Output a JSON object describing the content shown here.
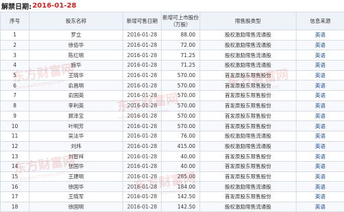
{
  "header": {
    "label": "解禁日期:",
    "date": "2016-01-28"
  },
  "table": {
    "columns": [
      "序号",
      "股东名称",
      "新增可售日期",
      "新增可上市股份（万股）",
      "限售股类型",
      "信息来源"
    ],
    "rows": [
      [
        "1",
        "罗立",
        "2016-01-28",
        "88.00",
        "股权激励限售流通股",
        "英语"
      ],
      [
        "2",
        "徐佰华",
        "2016-01-28",
        "72.00",
        "股权激励限售流通股",
        "英语"
      ],
      [
        "3",
        "陈红明",
        "2016-01-28",
        "71.25",
        "股权激励限售流通股",
        "英语"
      ],
      [
        "4",
        "施华",
        "2016-01-28",
        "71.25",
        "股权激励限售流通股",
        "英语"
      ],
      [
        "5",
        "王晓华",
        "2016-01-28",
        "570.00",
        "首发原股东限售股份",
        "英语"
      ],
      [
        "6",
        "俞昌明",
        "2016-01-28",
        "570.00",
        "首发原股东限售股份",
        "英语"
      ],
      [
        "7",
        "俞国英",
        "2016-01-28",
        "570.00",
        "首发原股东限售股份",
        "英语"
      ],
      [
        "8",
        "李利英",
        "2016-01-28",
        "570.00",
        "首发原股东限售股份",
        "英语"
      ],
      [
        "9",
        "顾泽宝",
        "2016-01-28",
        "570.00",
        "首发原股东限售股份",
        "英语"
      ],
      [
        "10",
        "叶明芳",
        "2016-01-28",
        "570.00",
        "首发原股东限售股份",
        "英语"
      ],
      [
        "11",
        "吴法华",
        "2016-01-28",
        "76.00",
        "股权激励限售流通股",
        "英语"
      ],
      [
        "12",
        "刘炜",
        "2016-01-28",
        "415.00",
        "股权激励限售流通股",
        "英语"
      ],
      [
        "13",
        "刘智祥",
        "2016-01-28",
        "40.00",
        "首发原股东限售股份",
        "英语"
      ],
      [
        "14",
        "张国华",
        "2016-01-28",
        "40.00",
        "首发原股东限售股份",
        "英语"
      ],
      [
        "15",
        "王建明",
        "2016-01-28",
        "285.00",
        "首发原股东限售股份",
        "英语"
      ],
      [
        "16",
        "徐国华",
        "2016-01-28",
        "184.00",
        "股权激励限售流通股",
        "英语"
      ],
      [
        "17",
        "王晓军",
        "2016-01-28",
        "142.50",
        "首发原股东限售股份",
        "英语"
      ],
      [
        "18",
        "徐国明",
        "2016-01-28",
        "142.50",
        "股权激励限售流通股",
        "英语"
      ]
    ]
  },
  "watermark": {
    "text": "东方财富网",
    "subtext": "www.eastmoney.com"
  }
}
